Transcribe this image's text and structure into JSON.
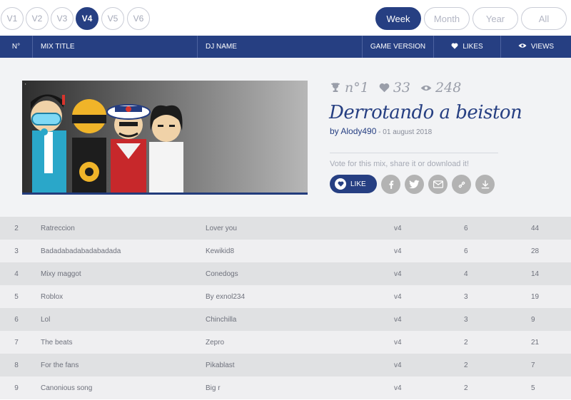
{
  "versions": [
    {
      "label": "V1",
      "active": false
    },
    {
      "label": "V2",
      "active": false
    },
    {
      "label": "V3",
      "active": false
    },
    {
      "label": "V4",
      "active": true
    },
    {
      "label": "V5",
      "active": false
    },
    {
      "label": "V6",
      "active": false
    }
  ],
  "periods": [
    {
      "label": "Week",
      "active": true
    },
    {
      "label": "Month",
      "active": false
    },
    {
      "label": "Year",
      "active": false
    },
    {
      "label": "All",
      "active": false
    }
  ],
  "columns": {
    "n": "N°",
    "title": "MIX TITLE",
    "dj": "DJ NAME",
    "version": "GAME VERSION",
    "likes": "LIKES",
    "views": "VIEWS"
  },
  "featured": {
    "rank": "n°1",
    "likes": "33",
    "views": "248",
    "title": "Derrotando a beiston",
    "by_prefix": "by",
    "author": "Alody490",
    "date": " - 01 august 2018",
    "vote_text": "Vote for this mix, share it or download it!",
    "like_label": "LIKE"
  },
  "rows": [
    {
      "n": "2",
      "title": "Ratreccion",
      "dj": "Lover you",
      "version": "v4",
      "likes": "6",
      "views": "44"
    },
    {
      "n": "3",
      "title": "Badadabadabadabadada",
      "dj": "Kewikid8",
      "version": "v4",
      "likes": "6",
      "views": "28"
    },
    {
      "n": "4",
      "title": "Mixy maggot",
      "dj": "Conedogs",
      "version": "v4",
      "likes": "4",
      "views": "14"
    },
    {
      "n": "5",
      "title": "Roblox",
      "dj": "By exnol234",
      "version": "v4",
      "likes": "3",
      "views": "19"
    },
    {
      "n": "6",
      "title": "Lol",
      "dj": "Chinchilla",
      "version": "v4",
      "likes": "3",
      "views": "9"
    },
    {
      "n": "7",
      "title": "The beats",
      "dj": "Zepro",
      "version": "v4",
      "likes": "2",
      "views": "21"
    },
    {
      "n": "8",
      "title": "For the fans",
      "dj": "Pikablast",
      "version": "v4",
      "likes": "2",
      "views": "7"
    },
    {
      "n": "9",
      "title": "Canonious song",
      "dj": "Big r",
      "version": "v4",
      "likes": "2",
      "views": "5"
    }
  ],
  "colors": {
    "brand": "#263f82",
    "row_dark": "#e0e1e3",
    "row_light": "#efeff1",
    "share_icon_bg": "#b3b3b3"
  },
  "icons": [
    "trophy-icon",
    "heart-icon",
    "eye-icon",
    "facebook-icon",
    "twitter-icon",
    "email-icon",
    "link-icon",
    "download-icon"
  ]
}
